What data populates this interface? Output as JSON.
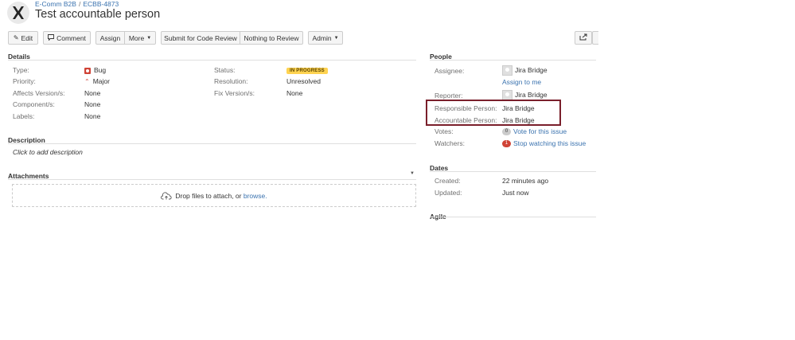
{
  "header": {
    "project": "E-Comm B2B",
    "separator": "/",
    "issue_key": "ECBB-4873",
    "title": "Test accountable person"
  },
  "toolbar": {
    "edit": "Edit",
    "comment": "Comment",
    "assign": "Assign",
    "more": "More",
    "submit_code_review": "Submit for Code Review",
    "nothing_to_review": "Nothing to Review",
    "admin": "Admin"
  },
  "details": {
    "heading": "Details",
    "type_label": "Type:",
    "type_value": "Bug",
    "priority_label": "Priority:",
    "priority_value": "Major",
    "affects_label": "Affects Version/s:",
    "affects_value": "None",
    "component_label": "Component/s:",
    "component_value": "None",
    "labels_label": "Labels:",
    "labels_value": "None",
    "status_label": "Status:",
    "status_value": "IN PROGRESS",
    "resolution_label": "Resolution:",
    "resolution_value": "Unresolved",
    "fix_label": "Fix Version/s:",
    "fix_value": "None"
  },
  "description": {
    "heading": "Description",
    "placeholder": "Click to add description"
  },
  "attachments": {
    "heading": "Attachments",
    "drop_text": "Drop files to attach, or",
    "browse": "browse."
  },
  "people": {
    "heading": "People",
    "assignee_label": "Assignee:",
    "assignee_value": "Jira Bridge",
    "assign_to_me": "Assign to me",
    "reporter_label": "Reporter:",
    "reporter_value": "Jira Bridge",
    "responsible_label": "Responsible Person:",
    "responsible_value": "Jira Bridge",
    "accountable_label": "Accountable Person:",
    "accountable_value": "Jira Bridge",
    "votes_label": "Votes:",
    "votes_count": "0",
    "vote_link": "Vote for this issue",
    "watchers_label": "Watchers:",
    "watchers_count": "1",
    "watch_link": "Stop watching this issue"
  },
  "dates": {
    "heading": "Dates",
    "created_label": "Created:",
    "created_value": "22 minutes ago",
    "updated_label": "Updated:",
    "updated_value": "Just now"
  },
  "agile": {
    "heading": "Agile"
  },
  "colors": {
    "link": "#3b73af",
    "status_badge": "#ffd351",
    "bug": "#d04437",
    "highlight_box": "#7a1f2b"
  },
  "icons": [
    "project-logo-icon",
    "pencil-icon",
    "comment-icon",
    "caret-down-icon",
    "share-icon",
    "bug-icon",
    "major-priority-icon",
    "avatar-icon",
    "upload-cloud-icon"
  ]
}
